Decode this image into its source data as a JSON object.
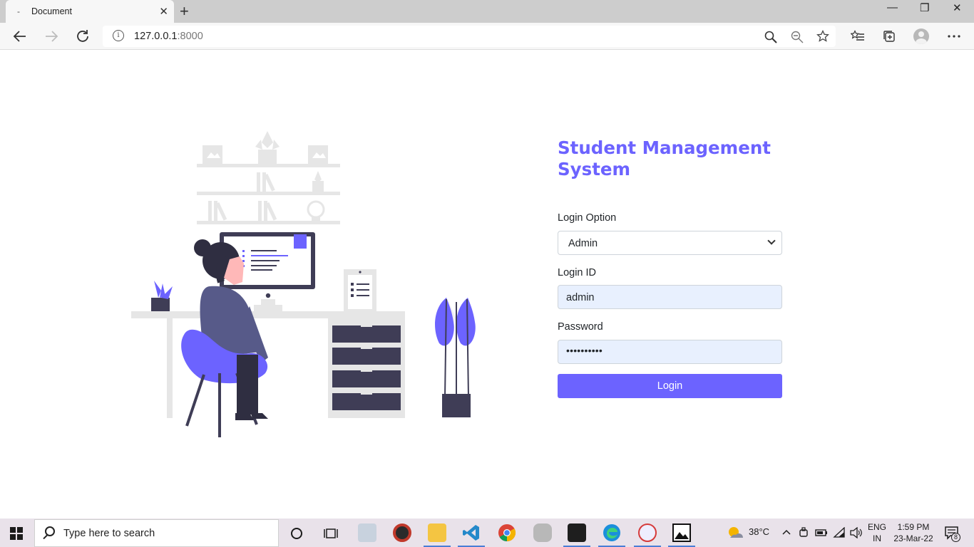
{
  "browser": {
    "tab_favicon": "-",
    "tab_title": "Document",
    "tab_close": "✕",
    "new_tab": "+",
    "url_host": "127.0.0.1",
    "url_port": ":8000",
    "window_controls": {
      "minimize": "—",
      "restore": "❐",
      "close": "✕"
    },
    "icons": [
      "back-arrow-icon",
      "forward-arrow-icon",
      "refresh-icon",
      "site-info-icon",
      "zoom-icon",
      "zoom-out-icon",
      "favorite-star-icon",
      "favorites-list-icon",
      "collections-icon",
      "profile-icon",
      "more-menu-icon"
    ]
  },
  "page": {
    "title": "Student Management System",
    "login_option_label": "Login Option",
    "login_option_value": "Admin",
    "login_id_label": "Login ID",
    "login_id_value": "admin",
    "password_label": "Password",
    "password_value": "••••••••••",
    "login_button": "Login",
    "accent_color": "#6c63ff",
    "autofill_color": "#e8f0fe"
  },
  "taskbar": {
    "search_placeholder": "Type here to search",
    "weather": "38°C",
    "language_line1": "ENG",
    "language_line2": "IN",
    "time": "1:59 PM",
    "date": "23-Mar-22",
    "notification_count": "8"
  }
}
